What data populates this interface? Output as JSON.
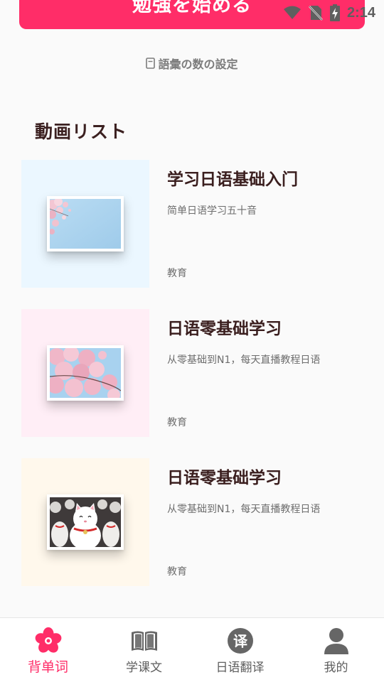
{
  "status_bar": {
    "time": "2:14"
  },
  "start_button": {
    "label": "勉強を始める"
  },
  "vocab_setting": {
    "label": "語彙の数の設定"
  },
  "section": {
    "title": "動画リスト"
  },
  "videos": [
    {
      "title": "学习日语基础入门",
      "description": "简单日语学习五十音",
      "tag": "教育",
      "thumbnail": "cherry-blossom-sky",
      "bg_color": "#ebf7ff"
    },
    {
      "title": "日语零基础学习",
      "description": "从零基础到N1，每天直播教程日语",
      "tag": "教育",
      "thumbnail": "cherry-blossom-branch",
      "bg_color": "#ffeef6"
    },
    {
      "title": "日语零基础学习",
      "description": "从零基础到N1，每天直播教程日语",
      "tag": "教育",
      "thumbnail": "maneki-neko-cats",
      "bg_color": "#fff8ec"
    }
  ],
  "bottom_nav": {
    "active_color": "#ff2d68",
    "items": [
      {
        "label": "背单词",
        "icon": "sakura-flower-icon",
        "active": true
      },
      {
        "label": "学课文",
        "icon": "open-book-icon",
        "active": false
      },
      {
        "label": "日语翻译",
        "icon": "translate-icon",
        "active": false
      },
      {
        "label": "我的",
        "icon": "person-icon",
        "active": false
      }
    ]
  }
}
